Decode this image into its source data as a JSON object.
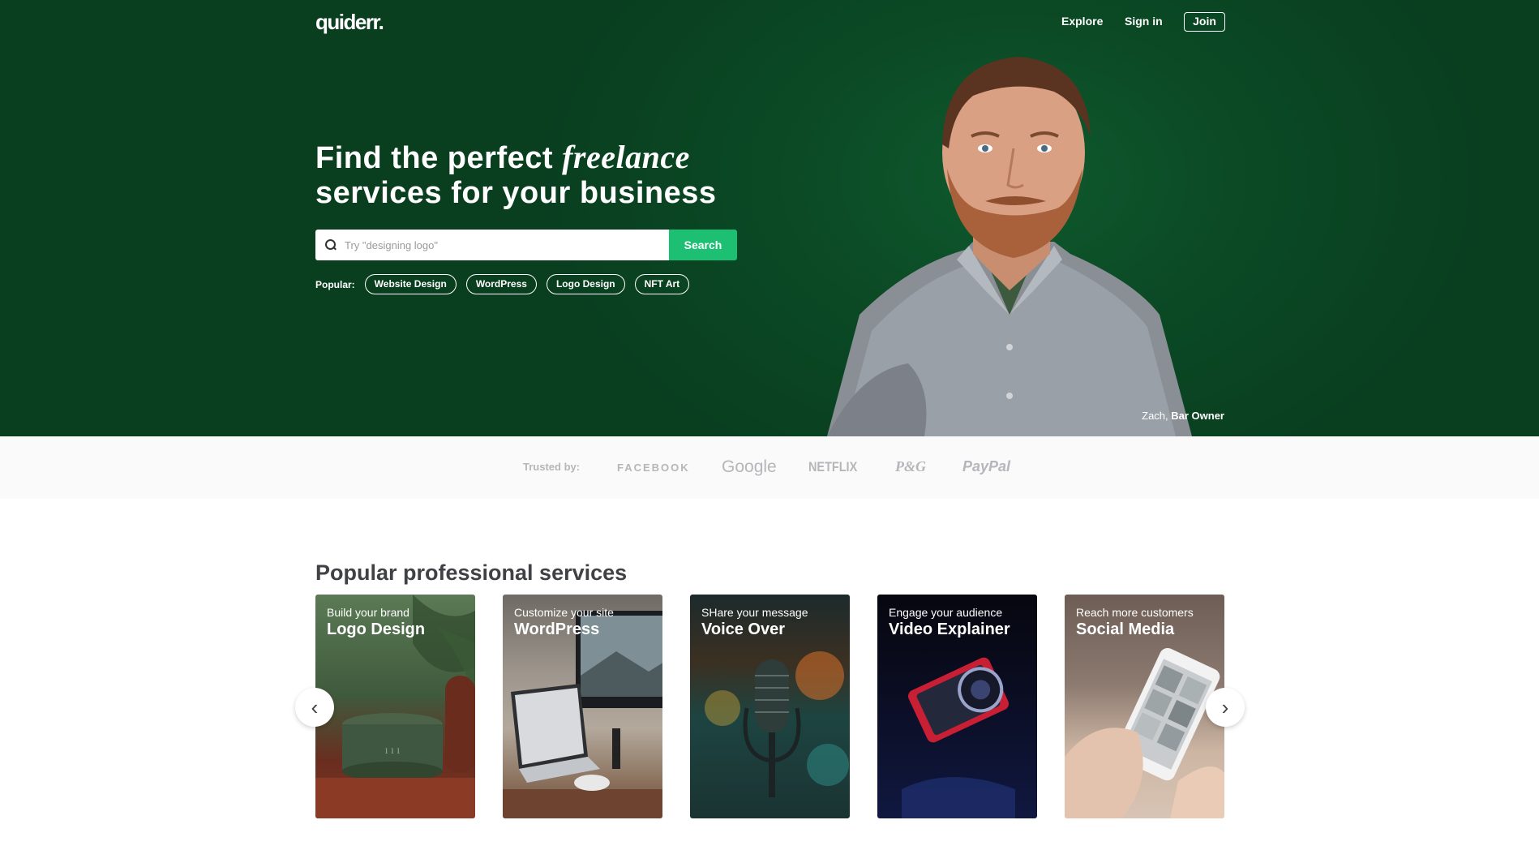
{
  "nav": {
    "logo": "quiderr.",
    "explore": "Explore",
    "signin": "Sign in",
    "join": "Join"
  },
  "hero": {
    "headline_part1": "Find the perfect ",
    "headline_italic": "freelance",
    "headline_part2": "services for your business",
    "search_placeholder": "Try \"designing logo\"",
    "search_button": "Search",
    "popular_label": "Popular:",
    "popular_tags": [
      "Website Design",
      "WordPress",
      "Logo Design",
      "NFT Art"
    ],
    "credit_name": "Zach, ",
    "credit_role": "Bar Owner"
  },
  "trusted": {
    "label": "Trusted by:",
    "brands": [
      "FACEBOOK",
      "Google",
      "NETFLIX",
      "P&G",
      "PayPal"
    ]
  },
  "services": {
    "title": "Popular professional services",
    "cards": [
      {
        "subtitle": "Build your brand",
        "title": "Logo Design"
      },
      {
        "subtitle": "Customize your site",
        "title": "WordPress"
      },
      {
        "subtitle": "SHare your message",
        "title": "Voice Over"
      },
      {
        "subtitle": "Engage your audience",
        "title": "Video Explainer"
      },
      {
        "subtitle": "Reach more customers",
        "title": "Social Media"
      }
    ],
    "prev_icon": "chevron-left-icon",
    "next_icon": "chevron-right-icon"
  },
  "colors": {
    "hero_bg": "#0b4a25",
    "accent": "#1dbf73",
    "trusted_bg": "#fafafa",
    "heading": "#404145"
  }
}
